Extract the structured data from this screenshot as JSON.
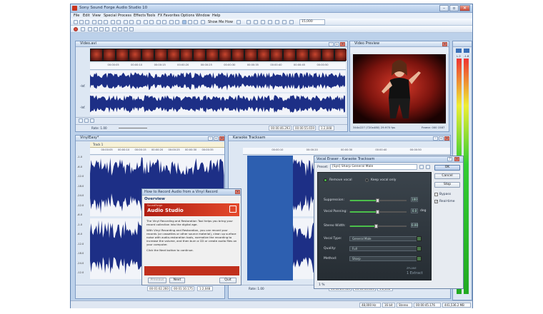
{
  "window": {
    "title": "Sony Sound Forge Audio Studio 10"
  },
  "menu": [
    "File",
    "Edit",
    "View",
    "Special",
    "Process",
    "Effects",
    "Tools",
    "FX Favorites",
    "Options",
    "Window",
    "Help"
  ],
  "toolbar": {
    "show_me_how": "Show Me How",
    "time_field": "15,000"
  },
  "video_avi": {
    "title": "Video.avi",
    "ruler": [
      "00:00:05",
      "00:00:10",
      "00:00:15",
      "00:00:20",
      "00:00:25",
      "00:00:30",
      "00:00:35",
      "00:00:40",
      "00:00:45",
      "00:00:50"
    ],
    "rate": "Rate: 1.00",
    "status_time": "00:00:46.293",
    "status_len": "00:00:55.659",
    "status_zoom": "1:2,048",
    "db_left": "-Inf.",
    "db_right": "-Inf."
  },
  "video_preview": {
    "title": "Video Preview",
    "info_left": "344x227 (720x480) 29.970 fps",
    "info_right": "Frame: 000 1587"
  },
  "vinyl": {
    "title": "VinylEasy*",
    "track": "Track 1",
    "ruler": [
      "00:00:05",
      "00:00:10",
      "00:00:15",
      "00:00:20",
      "00:00:25",
      "00:00:30",
      "00:00:35"
    ],
    "db_scale": [
      "-1.0",
      "-6.0",
      "-12.0",
      "-18.0",
      "-24.0",
      "-12.0",
      "-6.0",
      "-1.0",
      "-6.0",
      "-12.0",
      "-18.0",
      "-24.0",
      "-12.0"
    ],
    "status_time": "00:01:02.260",
    "status_len": "00:01:10.175",
    "status_zoom": "1:2,048"
  },
  "karaoke": {
    "title": "Karaoke Tracksam",
    "ruler": [
      "00:00:10",
      "00:00:20",
      "00:00:30",
      "00:00:40",
      "00:00:50"
    ],
    "rate": "Rate: 1.00",
    "status_time": "00:00:23.980",
    "status_len": "00:00:43.800",
    "status_zoom": "1:2,048"
  },
  "vinyl_dialog": {
    "title": "How to Record Audio from a Vinyl Record",
    "header": "Overview",
    "brand_small": "SoundForge",
    "brand": "Audio Studio",
    "para1": "The Vinyl Recording and Restoration Tool helps you bring your record collection into the digital age.",
    "para2": "With Vinyl Recording and Restoration, you can record your records (or cassettes or other source material), clean up surface noise with audio-restoration tools, normalize the recording to increase the volume, and then burn a CD or create audio files on your computer.",
    "para3": "Click the Next button to continue.",
    "previous": "Previous",
    "next": "Next",
    "quit": "Quit"
  },
  "vocal_eraser": {
    "title": "Vocal Eraser - Karaoke Tracksam",
    "preset_label": "Preset:",
    "preset_value": "[Sys] Sharp General Male",
    "ok": "OK",
    "cancel": "Cancel",
    "stop": "Stop",
    "bypass": "Bypass",
    "realtime": "Real-time",
    "remove_vocal": "Remove vocal",
    "keep_vocal": "Keep vocal only",
    "suppression_label": "Suppression:",
    "suppression_value": "100",
    "suppression_level": 0.5,
    "vocal_panning_label": "Vocal Panning:",
    "vocal_panning_value": "0.0",
    "vocal_panning_unit": "deg",
    "vocal_panning_level": 0.5,
    "stereo_width_label": "Stereo Width:",
    "stereo_width_value": "0.00",
    "stereo_width_level": 0.48,
    "vocal_type_label": "Vocal Type:",
    "vocal_type_value": "General Male",
    "quality_label": "Quality:",
    "quality_value": "Full",
    "method_label": "Method:",
    "method_value": "Sharp",
    "brand": "ZPLANE",
    "brand_sub": "1 Extract",
    "footer": "1 %"
  },
  "statusbar": [
    "48,000 Hz",
    "16 bit",
    "Stereo",
    "00:00:45.176",
    "441,536.2 MB"
  ],
  "meter_labels": [
    "L.2",
    "-1.8"
  ]
}
